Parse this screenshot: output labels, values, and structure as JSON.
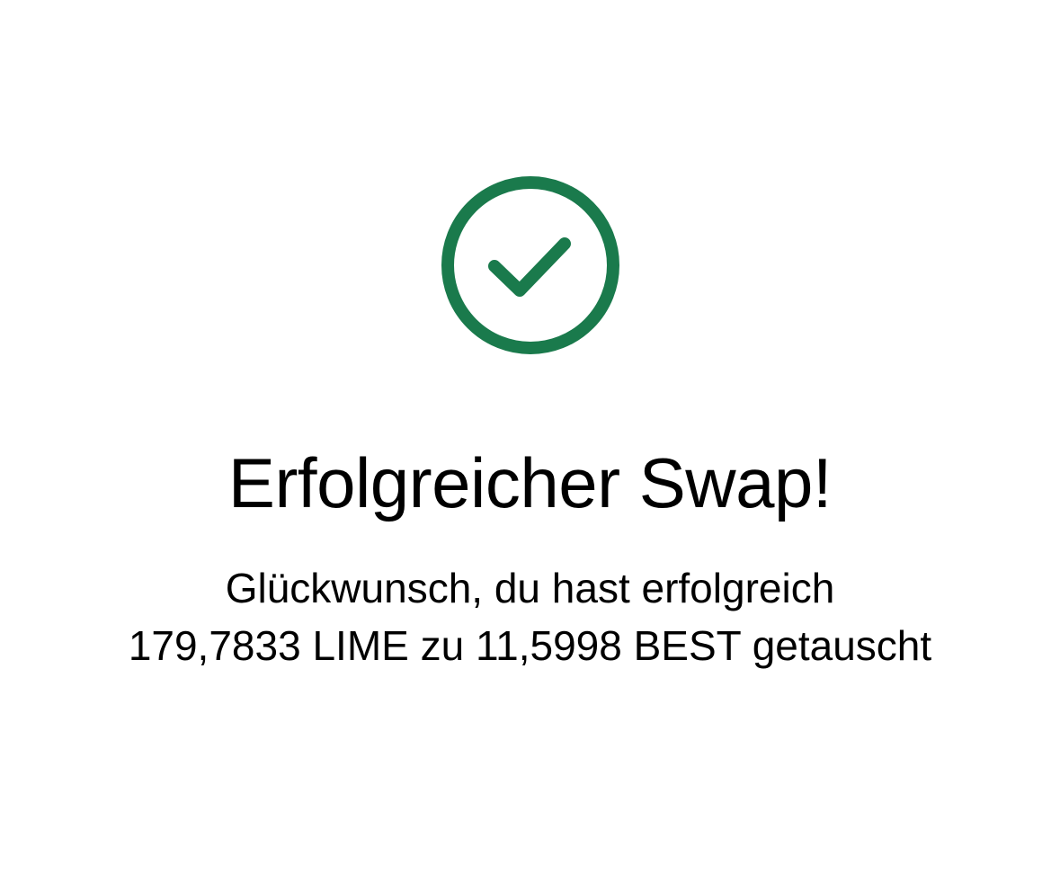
{
  "success": {
    "icon": "check-circle-icon",
    "accent_color": "#1a7a4c",
    "title": "Erfolgreicher Swap!",
    "message_line1": "Glückwunsch, du hast erfolgreich",
    "message_line2": "179,7833 LIME zu 11,5998 BEST getauscht"
  }
}
